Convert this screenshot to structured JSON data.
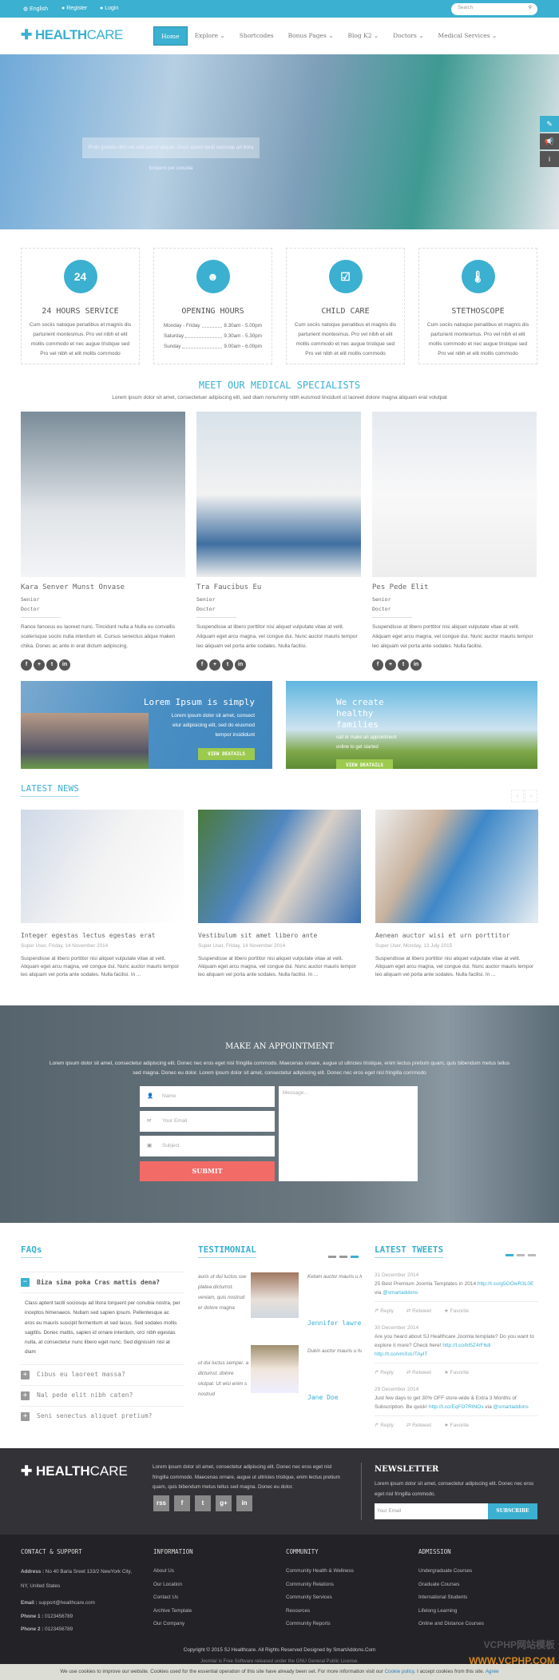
{
  "topbar": {
    "language": "English",
    "register": "Register",
    "login": "Login",
    "search_placeholder": "Search"
  },
  "logo": {
    "bold": "HEALTH",
    "light": "CARE"
  },
  "nav": [
    "Home",
    "Explore ⌄",
    "Shortcodes",
    "Bonus Pages ⌄",
    "Blog K2 ⌄",
    "Doctors ⌄",
    "Medical Services ⌄"
  ],
  "hero": {
    "caption": "Proin gravida nibh vel velit auctor aliquet. Class aptent taciti sociosqu ad litora torquent per conubia"
  },
  "services": [
    {
      "icon": "24-hours-icon",
      "glyph": "24",
      "title": "24 HOURS SERVICE",
      "text": "Cum sociis natoque penatibus et magnis dis parturient montesmus. Pro vel nibh et elit mollis commodo et nec augue tristique sed Pro vel nibh et elit mollis commodo"
    },
    {
      "icon": "baby-icon",
      "glyph": "☻",
      "title": "OPENING HOURS",
      "hours": [
        {
          "day": "Monday - Friday",
          "time": "8.30am - 5.00pm"
        },
        {
          "day": "Saturday",
          "time": "9.30am - 5.30pm"
        },
        {
          "day": "Sunday",
          "time": "9.00am - 6.00pm"
        }
      ]
    },
    {
      "icon": "checklist-icon",
      "glyph": "☑",
      "title": "CHILD CARE",
      "text": "Cum sociis natoque penatibus et magnis dis parturient montesmus. Pro vel nibh et elit mollis commodo et nec augue tristique sed Pro vel nibh et elit mollis commodo"
    },
    {
      "icon": "thermometer-icon",
      "glyph": "🌡",
      "title": "STETHOSCOPE",
      "text": "Cum sociis natoque penatibus et magnis dis parturient montesmus. Pro vel nibh et elit mollis commodo et nec augue tristique sed Pro vel nibh et elit mollis commodo"
    }
  ],
  "specialists": {
    "title": "MEET OUR MEDICAL SPECIALISTS",
    "subtitle": "Lorem ipsum dolor sit amet, consectetuer adipiscing elit, sed diam nonummy nibh euismod tincidunt ut laoreet dolore magna aliquam erat volutpat",
    "items": [
      {
        "name": "Kara Senver Munst Onvase",
        "role1": "Senior",
        "role2": "Doctor",
        "text": "Rance fanceus eu laoreet nunc. Tincidunt nulla a Nulla eu convallis scelerisque sociis nulla interdum et. Cursus senectus alique maken chika. Donec ac ante in erat dictum adipiscing."
      },
      {
        "name": "Tra Faucibus Eu",
        "role1": "Senior",
        "role2": "Doctor",
        "text": "Suspendisse at libero porttitor nisi aliquet vulputate vitae at velit. Aliquam eget arcu magna, vel congue dui. Nunc auctor mauris tempor leo aliquam vel porta ante sodales. Nulla facilisi."
      },
      {
        "name": "Pes Pede Elit",
        "role1": "Senior",
        "role2": "Doctor",
        "text": "Suspendisse at libero porttitor nisi aliquet vulputate vitae at velit. Aliquam eget arcu magna, vel congue dui. Nunc auctor mauris tempor leo aliquam vel porta ante sodales. Nulla facilisi."
      }
    ],
    "social": [
      "f",
      "+",
      "t",
      "in"
    ]
  },
  "banners": [
    {
      "title": "Lorem Ipsum is simply",
      "text": "Lorem ipsum dolor sit amet, consect etur adipisicing elit, sed do eiusmod tempor incididunt",
      "button": "VIEW DEATAILS"
    },
    {
      "title": "We create healthy families",
      "text": "call or make an appointment online to get started",
      "button": "VIEW DEATAILS"
    }
  ],
  "news": {
    "title": "LATEST NEWS",
    "items": [
      {
        "title": "Integer egestas lectus egestas erat",
        "meta": "Super User, Friday, 14 November 2014",
        "text": "Suspendisse at libero porttitor nisi aliquet vulputate vitae at velit. Aliquam eget arcu magna, vel congue dui. Nunc auctor mauris tempor leo aliquam vel porta ante sodales. Nulla facilisi. In ..."
      },
      {
        "title": "Vestibulum sit amet libero ante",
        "meta": "Super User, Friday, 14 November 2014",
        "text": "Suspendisse at libero porttitor nisi aliquet vulputate vitae at velit. Aliquam eget arcu magna, vel congue dui. Nunc auctor mauris tempor leo aliquam vel porta ante sodales. Nulla facilisi. In ..."
      },
      {
        "title": "Aenean auctor wisi et urn porttitor",
        "meta": "Super User, Monday, 13 July 2015",
        "text": "Suspendisse at libero porttitor nisi aliquet vulputate vitae at velit. Aliquam eget arcu magna, vel congue dui. Nunc auctor mauris tempor leo aliquam vel porta ante sodales. Nulla facilisi. In ..."
      }
    ]
  },
  "appointment": {
    "title": "MAKE AN APPOINTMENT",
    "text": "Lorem ipsum dolor sit amet, consectetur adipiscing elit. Donec nec eros eget nisl fringilla commodo. Maecenas ornare, augue ut ultricies tristique, enim lectus pretium quam, quis bibendum metus tellus sed magna. Donec eu dolor. Lorem ipsum dolor sit amet, consectetur adipiscing elit. Donec nec eros eget nisl fringilla commodo",
    "name_ph": "Name",
    "email_ph": "Your Email",
    "subject_ph": "Subject",
    "message_ph": "Message...",
    "submit": "SUBMIT"
  },
  "faqs": {
    "title": "FAQs",
    "items": [
      {
        "q": "Biza sima poka Cras mattis dena?",
        "open": true,
        "a": "Class aptent taciti sociosqu ad litora torquent per conubia nostra, per inceptos himenaeos. Nullam sed sapien ipsum. Pellentesque ac eros eu mauris suscipit fermentum et sed lacus. Sed sodales mollis sagittis. Donec mattis, sapien id ornare interdum, orci nibh egestas nulla, at consectetur nunc libero eget nunc. Sed dignissim nisl at diam"
      },
      {
        "q": "Cibus eu laoreet massa?"
      },
      {
        "q": "Nal pede elit nibh caten?"
      },
      {
        "q": "Seni senectus aliquet pretium?"
      }
    ]
  },
  "testimonial": {
    "title": "TESTIMONIAL",
    "items": [
      {
        "left": "auris ut dui luctus sse platea dictumst. veniam, quis nostrud er dolore magna",
        "right": "Ketam auctor mauris u In hac habitasse plate enim ad minim veniam tation ullamcorper nor",
        "name": "Jennifer lawrence"
      },
      {
        "left": "ut dui luctus semper. a dictumst. dolore olutpat. Ut wisi enim s nostrud",
        "right": "Dukin auctor mauris u hac habitasse platea d pellentesque ligula a r nostrud exerci tation u",
        "name": "Jane Doe"
      }
    ]
  },
  "tweets": {
    "title": "LATEST TWEETS",
    "items": [
      {
        "date": "31 December 2014",
        "text": "25 Best Premium Joomla Templates in 2014",
        "link": "http://t.co/g5OOwR3L0E",
        "via": "via",
        "handle": "@smartaddons"
      },
      {
        "date": "30 December 2014",
        "text": "Are you heard about SJ Healthcare Joomla template? Do you want to explore it more? Check here!",
        "link": "http://t.co/bI5Z4rF6di",
        "link2": "http://t.co/vmXoUTAyIT"
      },
      {
        "date": "29 December 2014",
        "text": "Just few days to get 30% OFF store-wide & Extra 3 Months of Subscription. Be quick!",
        "link": "http://t.co/EqFO7RtNOs",
        "via": "via",
        "handle": "@smartaddons"
      }
    ],
    "reply": "Reply",
    "retweet": "Retweet",
    "favorite": "Favorite"
  },
  "footer": {
    "about": "Lorem ipsum dolor sit amet, consectetur adipiscing elit. Donec nec eros eget nisl fringilla commodo. Maecenas ornare, augue ut ultricies tristique, enim lectus pretium quam, quis bibendum metus tellus sed magna. Donec eu dolor.",
    "social": [
      "rss",
      "f",
      "t",
      "g+",
      "in"
    ],
    "newsletter": {
      "title": "NEWSLETTER",
      "text": "Lorem ipsum dolor sit amet, consectetur adipiscing elit. Donec nec eros eget nisl fringilla commodo.",
      "placeholder": "Your Email",
      "button": "SUBSCRIBE"
    },
    "contact": {
      "title": "CONTACT & SUPPORT",
      "address_label": "Address :",
      "address": "No 40 Baria Sreet 133/2 NewYork City, NY, United States",
      "email_label": "Email :",
      "email": "support@healthcare.com",
      "phone1_label": "Phone 1 :",
      "phone1": "0123456789",
      "phone2_label": "Phone 2 :",
      "phone2": "0123456789"
    },
    "information": {
      "title": "INFORMATION",
      "links": [
        "About Us",
        "Our Location",
        "Contact Us",
        "Archive Template",
        "Our Company"
      ]
    },
    "community": {
      "title": "COMMUNITY",
      "links": [
        "Community Health & Wellness",
        "Community Relations",
        "Community Services",
        "Resources",
        "Community Reports"
      ]
    },
    "admission": {
      "title": "ADMISSION",
      "links": [
        "Undergraduate Courses",
        "Graduate Courses",
        "International Students",
        "Lifelong Learning",
        "Online and Distance Courses"
      ]
    },
    "copyright": "Copyright © 2015 SJ Healthcare. All Rights Reserved Designed by SmartAddons.Com",
    "license": "Joomla! is Free Software released under the GNU General Public License."
  },
  "cookie": {
    "text": "We use cookies to improve our website. Cookies used for the essential operation of this site have already been set. For more information visit our",
    "link": "Cookie policy",
    "accept": ". I accept cookies from this site.",
    "agree": "Agree"
  },
  "watermark": "VCPHP网站模板 WWW.VCPHP.COM",
  "colors": {
    "accent": "#3bb0d0",
    "submit": "#f26b67",
    "button_green": "#9cca4f",
    "footer": "#333236"
  }
}
